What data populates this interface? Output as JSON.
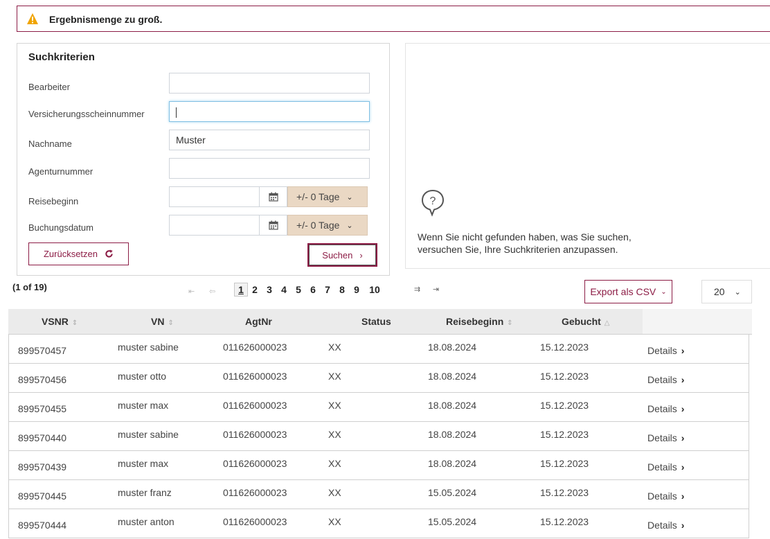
{
  "alert": {
    "message": "Ergebnismenge zu groß.",
    "accent": "#8c1c45"
  },
  "search": {
    "title": "Suchkriterien",
    "fields": [
      {
        "label": "Bearbeiter",
        "value": ""
      },
      {
        "label": "Versicherungsscheinnummer",
        "value": ""
      },
      {
        "label": "Nachname",
        "value": "Muster"
      },
      {
        "label": "Agenturnummer",
        "value": ""
      },
      {
        "label": "Reisebeginn",
        "value": "",
        "range": "+/- 0 Tage"
      },
      {
        "label": "Buchungsdatum",
        "value": "",
        "range": "+/- 0 Tage"
      }
    ],
    "reset_label": "Zurücksetzen",
    "search_label": "Suchen"
  },
  "info": {
    "line1": "Wenn Sie nicht gefunden haben, was Sie suchen,",
    "line2": "versuchen Sie, Ihre Suchkriterien anzupassen."
  },
  "pager": {
    "summary": "(1 of 19)",
    "pages": [
      "1",
      "2",
      "3",
      "4",
      "5",
      "6",
      "7",
      "8",
      "9",
      "10"
    ],
    "current": "1",
    "export_label": "Export als CSV",
    "rows_per_page": "20"
  },
  "table": {
    "columns": [
      "VSNR",
      "VN",
      "AgtNr",
      "Status",
      "Reisebeginn",
      "Gebucht"
    ],
    "details_label": "Details",
    "rows": [
      [
        "899570457",
        "muster sabine",
        "011626000023",
        "XX",
        "18.08.2024",
        "15.12.2023"
      ],
      [
        "899570456",
        "muster otto",
        "011626000023",
        "XX",
        "18.08.2024",
        "15.12.2023"
      ],
      [
        "899570455",
        "muster max",
        "011626000023",
        "XX",
        "18.08.2024",
        "15.12.2023"
      ],
      [
        "899570440",
        "muster sabine",
        "011626000023",
        "XX",
        "18.08.2024",
        "15.12.2023"
      ],
      [
        "899570439",
        "muster max",
        "011626000023",
        "XX",
        "18.08.2024",
        "15.12.2023"
      ],
      [
        "899570445",
        "muster franz",
        "011626000023",
        "XX",
        "15.05.2024",
        "15.12.2023"
      ],
      [
        "899570444",
        "muster anton",
        "011626000023",
        "XX",
        "15.05.2024",
        "15.12.2023"
      ]
    ]
  }
}
